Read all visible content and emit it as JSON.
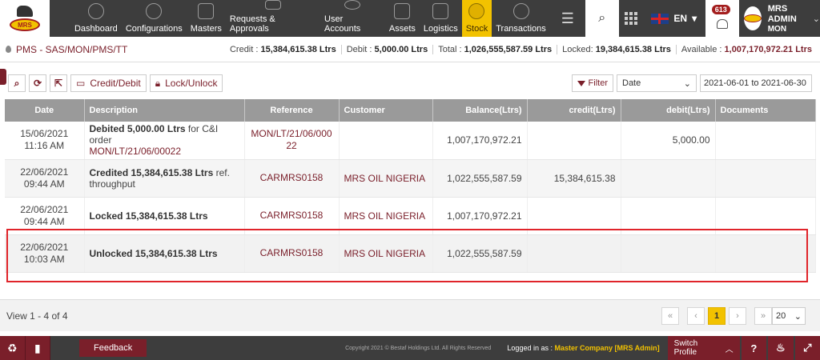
{
  "nav": {
    "logo_text": "MRS",
    "items": [
      {
        "label": "Dashboard",
        "icon": "dashboard-icon"
      },
      {
        "label": "Configurations",
        "icon": "gears-icon"
      },
      {
        "label": "Masters",
        "icon": "building-icon"
      },
      {
        "label": "Requests & Approvals",
        "icon": "document-icon"
      },
      {
        "label": "User Accounts",
        "icon": "users-icon"
      },
      {
        "label": "Assets",
        "icon": "factory-icon"
      },
      {
        "label": "Logistics",
        "icon": "truck-icon"
      },
      {
        "label": "Stock",
        "icon": "coins-icon",
        "active": true
      },
      {
        "label": "Transactions",
        "icon": "transfer-icon"
      }
    ],
    "language": "EN",
    "notification_count": "613",
    "user_name": "MRS ADMIN",
    "user_role": "MON"
  },
  "statbar": {
    "breadcrumb": "PMS - SAS/MON/PMS/TT",
    "credit_label": "Credit :",
    "credit_value": "15,384,615.38 Ltrs",
    "debit_label": "Debit :",
    "debit_value": "5,000.00 Ltrs",
    "total_label": "Total :",
    "total_value": "1,026,555,587.59 Ltrs",
    "locked_label": "Locked:",
    "locked_value": "19,384,615.38 Ltrs",
    "available_label": "Available :",
    "available_value": "1,007,170,972.21 Ltrs"
  },
  "toolbar": {
    "credit_debit_label": "Credit/Debit",
    "lock_unlock_label": "Lock/Unlock",
    "filter_label": "Filter",
    "date_select_value": "Date",
    "date_range": "2021-06-01 to 2021-06-30"
  },
  "table": {
    "headers": {
      "date": "Date",
      "description": "Description",
      "reference": "Reference",
      "customer": "Customer",
      "balance": "Balance(Ltrs)",
      "credit": "credit(Ltrs)",
      "debit": "debit(Ltrs)",
      "documents": "Documents"
    },
    "rows": [
      {
        "date": "15/06/2021",
        "time": "11:16 AM",
        "desc_bold": "Debited 5,000.00 Ltrs",
        "desc_rest": " for C&I order",
        "desc_link": "MON/LT/21/06/00022",
        "reference": "MON/LT/21/06/000 22",
        "customer": "",
        "balance": "1,007,170,972.21",
        "credit": "",
        "debit": "5,000.00"
      },
      {
        "date": "22/06/2021",
        "time": "09:44 AM",
        "desc_bold": "Credited 15,384,615.38 Ltrs",
        "desc_rest": " ref. throughput",
        "desc_link": "",
        "reference": "CARMRS0158",
        "customer": "MRS OIL NIGERIA",
        "balance": "1,022,555,587.59",
        "credit": "15,384,615.38",
        "debit": ""
      },
      {
        "date": "22/06/2021",
        "time": "09:44 AM",
        "desc_bold": "Locked 15,384,615.38 Ltrs",
        "desc_rest": "",
        "desc_link": "",
        "reference": "CARMRS0158",
        "customer": "MRS OIL NIGERIA",
        "balance": "1,007,170,972.21",
        "credit": "",
        "debit": ""
      },
      {
        "date": "22/06/2021",
        "time": "10:03 AM",
        "desc_bold": "Unlocked 15,384,615.38 Ltrs",
        "desc_rest": "",
        "desc_link": "",
        "reference": "CARMRS0158",
        "customer": "MRS OIL NIGERIA",
        "balance": "1,022,555,587.59",
        "credit": "",
        "debit": ""
      }
    ]
  },
  "pager": {
    "view_text": "View 1 - 4 of 4",
    "first": "«",
    "prev": "‹",
    "current": "1",
    "next": "›",
    "last": "»",
    "page_size": "20"
  },
  "footer": {
    "feedback_label": "Feedback",
    "copyright": "Copyright 2021 © Bestaf Holdings Ltd. All Rights Reserved",
    "logged_in_label": "Logged in as :",
    "logged_in_company": "Master Company [MRS Admin]",
    "switch_profile_label": "Switch Profile"
  },
  "colors": {
    "accent": "#7a1f2a",
    "active_tab": "#f2c200",
    "nav_bg": "#3d3d3d",
    "highlight_border": "#e0242a"
  }
}
